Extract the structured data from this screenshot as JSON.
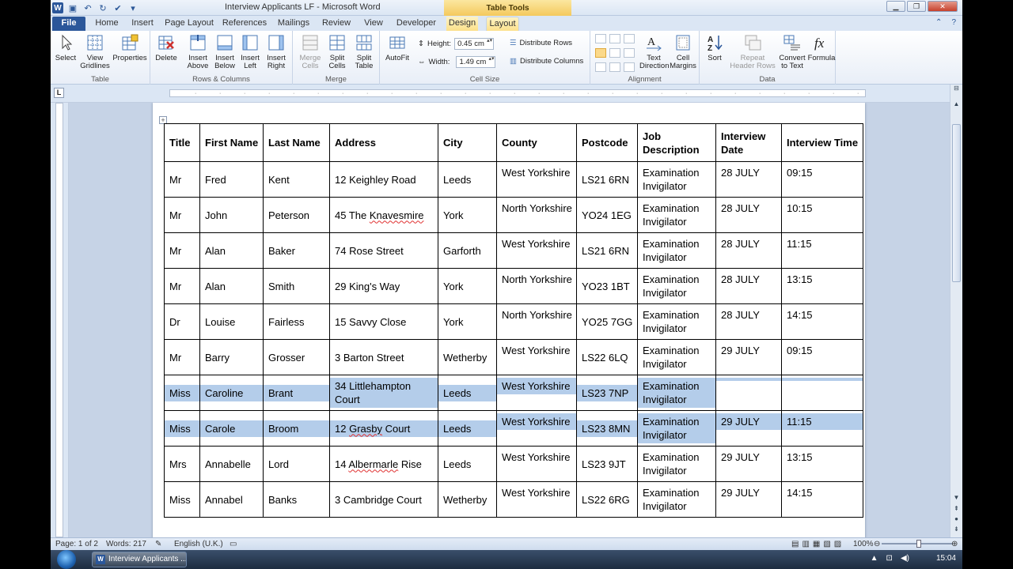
{
  "window": {
    "title": "Interview Applicants LF - Microsoft Word",
    "context_group": "Table Tools"
  },
  "tabs": [
    "File",
    "Home",
    "Insert",
    "Page Layout",
    "References",
    "Mailings",
    "Review",
    "View",
    "Developer",
    "Design",
    "Layout"
  ],
  "ribbon": {
    "groups": {
      "table": "Table",
      "rows_cols": "Rows & Columns",
      "merge": "Merge",
      "cell_size": "Cell Size",
      "alignment": "Alignment",
      "data": "Data"
    },
    "buttons": {
      "select": "Select",
      "view_gridlines_1": "View",
      "view_gridlines_2": "Gridlines",
      "properties": "Properties",
      "delete": "Delete",
      "insert_above_1": "Insert",
      "insert_above_2": "Above",
      "insert_below_1": "Insert",
      "insert_below_2": "Below",
      "insert_left_1": "Insert",
      "insert_left_2": "Left",
      "insert_right_1": "Insert",
      "insert_right_2": "Right",
      "merge_cells_1": "Merge",
      "merge_cells_2": "Cells",
      "split_cells_1": "Split",
      "split_cells_2": "Cells",
      "split_table_1": "Split",
      "split_table_2": "Table",
      "autofit": "AutoFit",
      "height_label": "Height:",
      "height_value": "0.45 cm",
      "width_label": "Width:",
      "width_value": "1.49 cm",
      "distribute_rows": "Distribute Rows",
      "distribute_columns": "Distribute Columns",
      "text_direction_1": "Text",
      "text_direction_2": "Direction",
      "cell_margins_1": "Cell",
      "cell_margins_2": "Margins",
      "sort": "Sort",
      "repeat_header_1": "Repeat",
      "repeat_header_2": "Header Rows",
      "convert_1": "Convert",
      "convert_2": "to Text",
      "formula": "Formula"
    }
  },
  "table": {
    "headers": [
      "Title",
      "First Name",
      "Last Name",
      "Address",
      "City",
      "County",
      "Postcode",
      "Job Description",
      "Interview Date",
      "Interview Time"
    ],
    "rows": [
      [
        "Mr",
        "Fred",
        "Kent",
        "12 Keighley Road",
        "Leeds",
        "West Yorkshire",
        "LS21 6RN",
        "Examination Invigilator",
        "28 JULY",
        "09:15"
      ],
      [
        "Mr",
        "John",
        "Peterson",
        "45 The Knavesmire",
        "York",
        "North Yorkshire",
        "YO24 1EG",
        "Examination Invigilator",
        "28 JULY",
        "10:15"
      ],
      [
        "Mr",
        "Alan",
        "Baker",
        "74 Rose Street",
        "Garforth",
        "West Yorkshire",
        "LS21 6RN",
        "Examination Invigilator",
        "28 JULY",
        "11:15"
      ],
      [
        "Mr",
        "Alan",
        "Smith",
        "29 King's Way",
        "York",
        "North Yorkshire",
        "YO23 1BT",
        "Examination Invigilator",
        "28 JULY",
        "13:15"
      ],
      [
        "Dr",
        "Louise",
        "Fairless",
        "15 Savvy Close",
        "York",
        "North Yorkshire",
        "YO25 7GG",
        "Examination Invigilator",
        "28 JULY",
        "14:15"
      ],
      [
        "Mr",
        "Barry",
        "Grosser",
        "3 Barton Street",
        "Wetherby",
        "West Yorkshire",
        "LS22 6LQ",
        "Examination Invigilator",
        "29 JULY",
        "09:15"
      ],
      [
        "Miss",
        "Caroline",
        "Brant",
        "34 Littlehampton Court",
        "Leeds",
        "West Yorkshire",
        "LS23 7NP",
        "Examination Invigilator",
        "",
        ""
      ],
      [
        "Miss",
        "Carole",
        "Broom",
        "12 Grasby Court",
        "Leeds",
        "West Yorkshire",
        "LS23 8MN",
        "Examination Invigilator",
        "29 JULY",
        "11:15"
      ],
      [
        "Mrs",
        "Annabelle",
        "Lord",
        "14 Albermarle Rise",
        "Leeds",
        "West Yorkshire",
        "LS23 9JT",
        "Examination Invigilator",
        "29 JULY",
        "13:15"
      ],
      [
        "Miss",
        "Annabel",
        "Banks",
        "3 Cambridge Court",
        "Wetherby",
        "West Yorkshire",
        "LS22 6RG",
        "Examination Invigilator",
        "29 JULY",
        "14:15"
      ]
    ],
    "highlighted_rows": [
      6,
      7
    ]
  },
  "status": {
    "page": "Page: 1 of 2",
    "words": "Words: 217",
    "language": "English (U.K.)",
    "zoom": "100%"
  },
  "taskbar": {
    "task": "Interview Applicants ...",
    "clock": "15:04"
  },
  "colors": {
    "selection": "#b4cdea",
    "ribbon_blue": "#2b579a",
    "context_tab": "#fbe08a"
  }
}
